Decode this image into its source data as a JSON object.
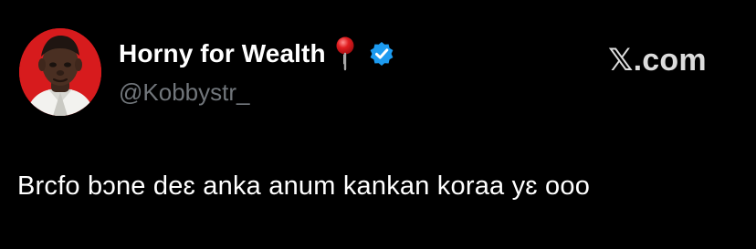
{
  "tweet": {
    "author": {
      "display_name": "Horny for Wealth",
      "handle": "@Kobbystr_",
      "name_emoji": "pin-icon",
      "verified_badge": "verified-badge-icon",
      "avatar": "profile-photo"
    },
    "source_label": "𝕏.com",
    "text": "Brcfo bɔne deɛ anka anum kankan koraa yɛ ooo"
  },
  "colors": {
    "background": "#000000",
    "display_name": "#ffffff",
    "handle": "#71767b",
    "verified_blue": "#1d9bf0",
    "avatar_background": "#d71b1d"
  }
}
